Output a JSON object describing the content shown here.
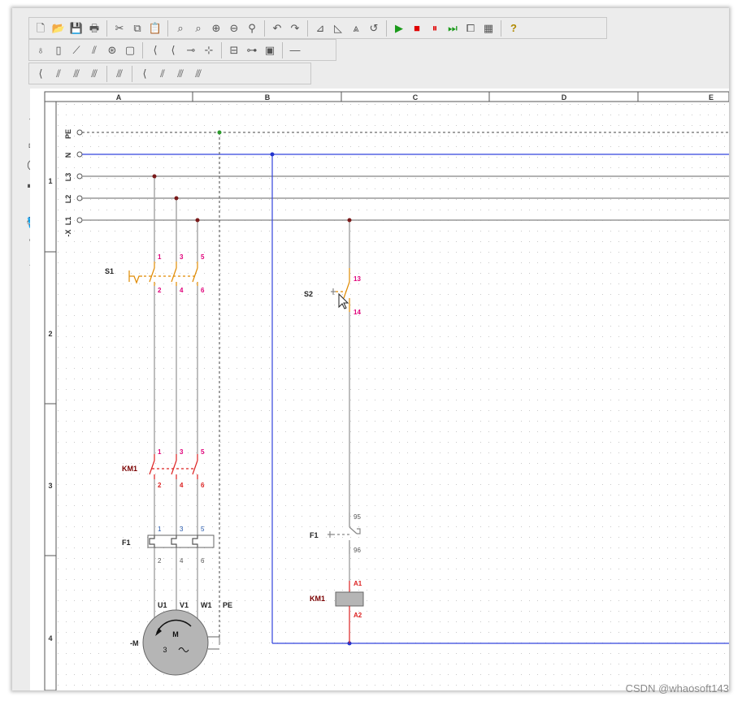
{
  "toolbar1": [
    {
      "name": "new-file-icon",
      "glyph": "🗋"
    },
    {
      "name": "open-folder-icon",
      "glyph": "📂"
    },
    {
      "name": "save-icon",
      "glyph": "💾"
    },
    {
      "name": "print-icon",
      "glyph": "🖶"
    },
    {
      "sep": true
    },
    {
      "name": "cut-icon",
      "glyph": "✂"
    },
    {
      "name": "copy-icon",
      "glyph": "⧉"
    },
    {
      "name": "paste-icon",
      "glyph": "📋"
    },
    {
      "sep": true
    },
    {
      "name": "zoom-page-icon",
      "glyph": "⌕"
    },
    {
      "name": "zoom-width-icon",
      "glyph": "⌕"
    },
    {
      "name": "zoom-in-icon",
      "glyph": "⊕"
    },
    {
      "name": "zoom-out-icon",
      "glyph": "⊖"
    },
    {
      "name": "zoom-select-icon",
      "glyph": "⚲"
    },
    {
      "sep": true
    },
    {
      "name": "undo-icon",
      "glyph": "↶"
    },
    {
      "name": "redo-icon",
      "glyph": "↷"
    },
    {
      "sep": true
    },
    {
      "name": "mirror-left-icon",
      "glyph": "⊿"
    },
    {
      "name": "mirror-right-icon",
      "glyph": "◺"
    },
    {
      "name": "flip-vertical-icon",
      "glyph": "⩓"
    },
    {
      "name": "rotate-icon",
      "glyph": "↺"
    },
    {
      "sep": true
    },
    {
      "name": "play-icon",
      "glyph": "▶",
      "cls": "btn-green"
    },
    {
      "name": "stop-icon",
      "glyph": "■",
      "cls": "btn-red"
    },
    {
      "name": "pause-icon",
      "glyph": "⏸",
      "cls": "btn-red"
    },
    {
      "name": "step-icon",
      "glyph": "⏭",
      "cls": "btn-green"
    },
    {
      "name": "window-icon",
      "glyph": "⧠"
    },
    {
      "name": "report-icon",
      "glyph": "▦"
    },
    {
      "sep": true
    },
    {
      "name": "help-icon",
      "glyph": "?",
      "cls": "btn-help"
    }
  ],
  "toolbar2": [
    {
      "name": "lamp-icon",
      "glyph": "♁"
    },
    {
      "name": "fuse-icon",
      "glyph": "▯"
    },
    {
      "name": "switch-icon",
      "glyph": "⟋"
    },
    {
      "name": "triple-switch-icon",
      "glyph": "⫽"
    },
    {
      "name": "motor-small-icon",
      "glyph": "⊛"
    },
    {
      "name": "coil-icon",
      "glyph": "▢"
    },
    {
      "sep": true
    },
    {
      "name": "contact-no-icon",
      "glyph": "⟨"
    },
    {
      "name": "contact-nc-icon",
      "glyph": "⟨"
    },
    {
      "name": "terminal-icon",
      "glyph": "⊸"
    },
    {
      "name": "node-icon",
      "glyph": "⊹"
    },
    {
      "sep": true
    },
    {
      "name": "relay-icon",
      "glyph": "⊟"
    },
    {
      "name": "timer-icon",
      "glyph": "⊶"
    },
    {
      "name": "io-icon",
      "glyph": "▣"
    },
    {
      "sep": true
    },
    {
      "name": "line-icon",
      "glyph": "—"
    }
  ],
  "toolbar3": [
    {
      "name": "contact1-icon",
      "glyph": "⟨"
    },
    {
      "name": "contact2-icon",
      "glyph": "⫽"
    },
    {
      "name": "contact3-icon",
      "glyph": "⫻"
    },
    {
      "name": "contact4-icon",
      "glyph": "⫻"
    },
    {
      "sep": true
    },
    {
      "name": "contact5-icon",
      "glyph": "⫻"
    },
    {
      "sep": true
    },
    {
      "name": "contact6-icon",
      "glyph": "⟨"
    },
    {
      "name": "contact7-icon",
      "glyph": "⫽"
    },
    {
      "name": "contact8-icon",
      "glyph": "⫻"
    },
    {
      "name": "contact9-icon",
      "glyph": "⫻"
    }
  ],
  "leftbar": [
    {
      "name": "select-arrow-icon",
      "glyph": "↖"
    },
    {
      "name": "draw-line-icon",
      "glyph": "╲"
    },
    {
      "name": "rectangle-icon",
      "glyph": "▭"
    },
    {
      "name": "ellipse-icon",
      "glyph": "◯"
    },
    {
      "name": "filled-rect-icon",
      "glyph": "▬"
    },
    {
      "name": "filled-ellipse-icon",
      "glyph": "●"
    },
    {
      "name": "fill-bucket-icon",
      "glyph": "🪣"
    },
    {
      "name": "pen-icon",
      "glyph": "✎"
    },
    {
      "name": "text-tool-icon",
      "glyph": "A"
    }
  ],
  "diagram": {
    "columns": [
      "A",
      "B",
      "C",
      "D",
      "E"
    ],
    "rows": [
      "1",
      "2",
      "3",
      "4"
    ],
    "terminals": [
      "PE",
      "N",
      "L3",
      "L2",
      "L1"
    ],
    "terminal_strip": "-X",
    "s1": {
      "ref": "S1",
      "pins_top": [
        "1",
        "3",
        "5"
      ],
      "pins_bottom": [
        "2",
        "4",
        "6"
      ]
    },
    "s2": {
      "ref": "S2",
      "pin_top": "13",
      "pin_bottom": "14"
    },
    "km1_main": {
      "ref": "KM1",
      "pins_top": [
        "1",
        "3",
        "5"
      ],
      "pins_bottom": [
        "2",
        "4",
        "6"
      ]
    },
    "f1_main": {
      "ref": "F1",
      "pins_top": [
        "1",
        "3",
        "5"
      ],
      "pins_bottom": [
        "2",
        "4",
        "6"
      ]
    },
    "f1_aux": {
      "ref": "F1",
      "pin_top": "95",
      "pin_bottom": "96"
    },
    "km1_coil": {
      "ref": "KM1",
      "pin_top": "A1",
      "pin_bottom": "A2"
    },
    "motor": {
      "ref": "-M",
      "symbol": "M",
      "phases": "3",
      "terminals": [
        "U1",
        "V1",
        "W1",
        "PE"
      ]
    }
  },
  "watermark": "CSDN @whaosoft143"
}
